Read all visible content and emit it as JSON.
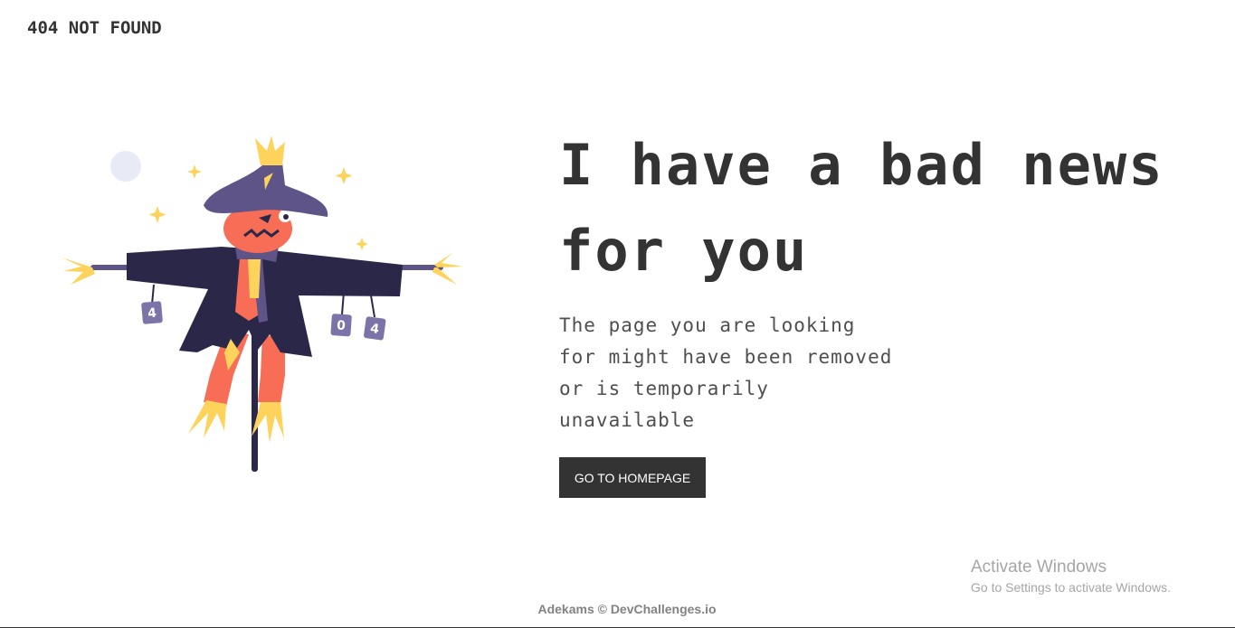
{
  "header": {
    "brand": "404 NOT FOUND"
  },
  "main": {
    "headline": "I have a bad news for you",
    "message": "The page you are looking for might have been removed or is temporarily unavailable",
    "button_label": "GO TO HOMEPAGE"
  },
  "illustration": {
    "can_labels": [
      "4",
      "0",
      "4"
    ]
  },
  "footer": {
    "credit": "Adekams © DevChallenges.io"
  },
  "os_watermark": {
    "title": "Activate Windows",
    "subtitle": "Go to Settings to activate Windows."
  },
  "colors": {
    "text": "#333333",
    "button_bg": "#333333",
    "button_text": "#ffffff",
    "footer_text": "#828282",
    "scarecrow_coat": "#2b2749",
    "scarecrow_hat": "#5e5487",
    "scarecrow_face": "#f76d55",
    "straw": "#fdd35c"
  }
}
